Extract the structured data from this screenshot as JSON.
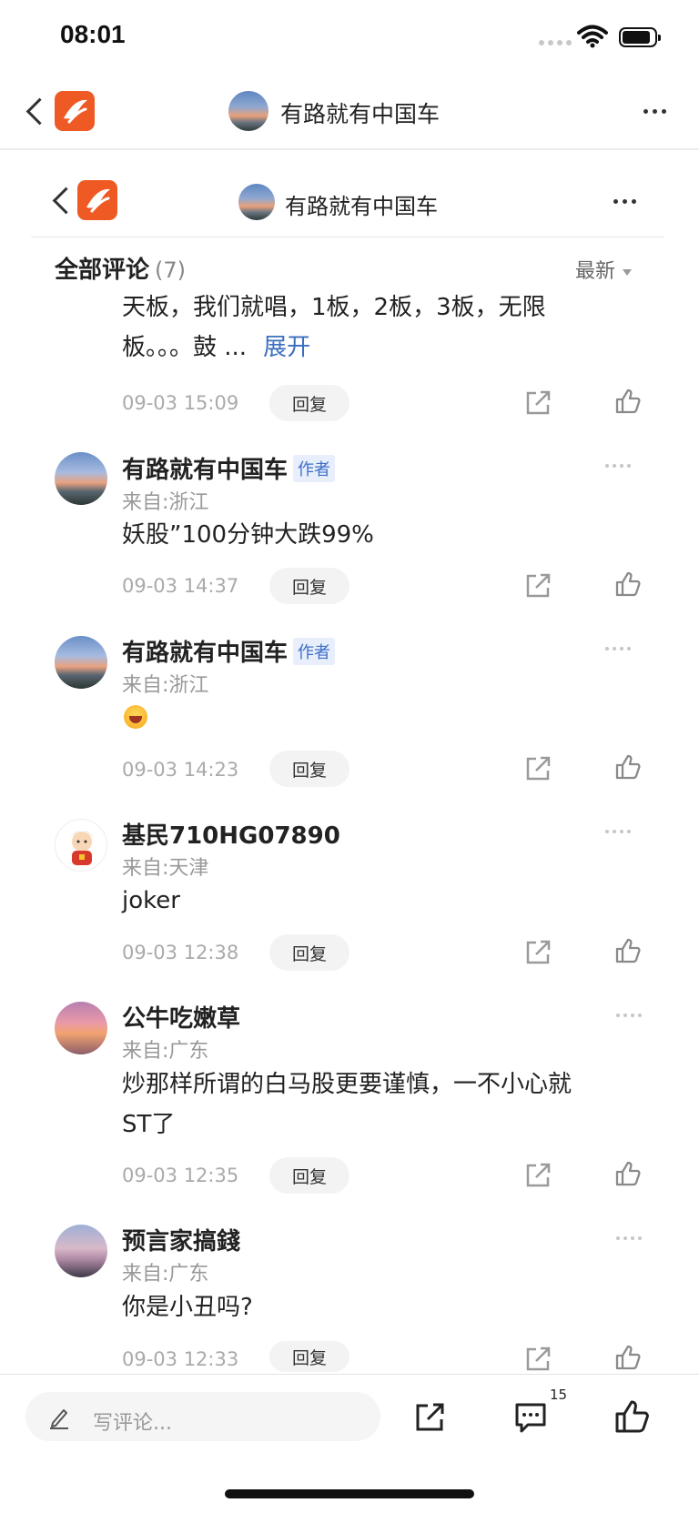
{
  "status": {
    "time": "08:01",
    "icons": [
      "signal-dots-icon",
      "wifi-icon",
      "battery-icon"
    ]
  },
  "outer_header": {
    "title": "有路就有中国车",
    "icons": [
      "back-icon",
      "app-logo-icon",
      "more-icon"
    ]
  },
  "inner_header": {
    "title": "有路就有中国车"
  },
  "comments_section": {
    "title": "全部评论",
    "count": "(7)",
    "sort_label": "最新"
  },
  "colors": {
    "brand": "#ef5a24",
    "link": "#3b6fbf",
    "badge": "#3d6fc7"
  },
  "comments": [
    {
      "text_line1": "天板，我们就唱，1板，2板，3板，无限",
      "text_line2": "板。。。鼓 ...",
      "expand": "展开",
      "time": "09-03 15:09",
      "reply": "回复"
    },
    {
      "user": "有路就有中国车",
      "badge": "作者",
      "location": "来自:浙江",
      "text": "妖股”100分钟大跌99%",
      "time": "09-03 14:37",
      "reply": "回复"
    },
    {
      "user": "有路就有中国车",
      "badge": "作者",
      "location": "来自:浙江",
      "emoji": "laughing-emoji-icon",
      "time": "09-03 14:23",
      "reply": "回复"
    },
    {
      "user": "基民710HG07890",
      "location": "来自:天津",
      "text": "joker",
      "time": "09-03 12:38",
      "reply": "回复"
    },
    {
      "user": "公牛吃嫩草",
      "location": "来自:广东",
      "text_line1": "炒那样所谓的白马股更要谨慎，一不小心就",
      "text_line2": "ST了",
      "time": "09-03 12:35",
      "reply": "回复"
    },
    {
      "user": "预言家搞錢",
      "location": "来自:广东",
      "text": "你是小丑吗?",
      "time": "09-03 12:33",
      "reply": "回复"
    }
  ],
  "bottom_bar": {
    "placeholder": "写评论...",
    "comment_count": "15",
    "icons": [
      "pen-icon",
      "share-icon",
      "comment-icon",
      "like-icon"
    ]
  }
}
